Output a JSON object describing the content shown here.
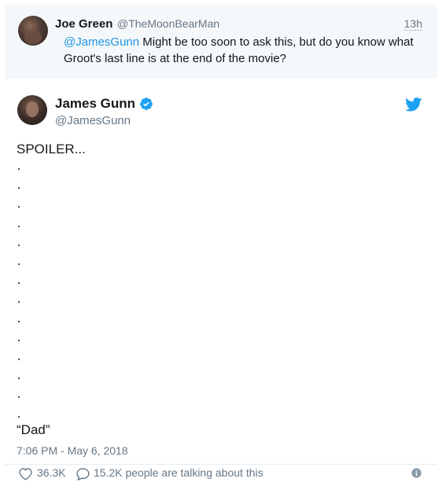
{
  "reply": {
    "name": "Joe Green",
    "handle": "@TheMoonBearMan",
    "time": "13h",
    "mention": "@JamesGunn",
    "text": " Might be too soon to ask this, but do you know what Groot's last line is at the end of the movie?"
  },
  "tweet": {
    "author_name": "James Gunn",
    "author_handle": "@JamesGunn",
    "verified": true,
    "line_spoiler": "SPOILER...",
    "dots": [
      ".",
      ".",
      ".",
      ".",
      ".",
      ".",
      ".",
      ".",
      ".",
      ".",
      ".",
      ".",
      ".",
      "."
    ],
    "line_quote": "“Dad”",
    "timestamp": "7:06 PM - May 6, 2018"
  },
  "stats": {
    "likes": "36.3K",
    "talking": "15.2K people are talking about this"
  },
  "icons": {
    "verified": "verified-badge-icon",
    "twitter": "twitter-bird-icon",
    "like": "heart-icon",
    "reply": "speech-bubble-icon",
    "info": "info-icon"
  },
  "colors": {
    "accent": "#1b95e0",
    "verified": "#1da1f2",
    "muted": "#657786",
    "reply_bg": "#f5f8fa"
  }
}
